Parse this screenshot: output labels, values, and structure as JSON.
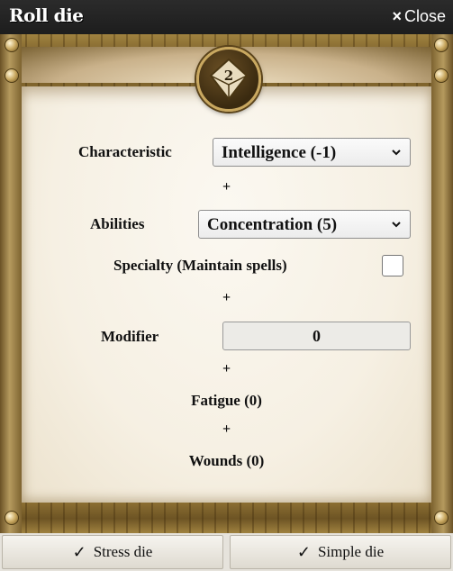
{
  "dialog": {
    "title": "Roll die",
    "close_label": "Close",
    "close_icon": "×"
  },
  "die": {
    "face": "2"
  },
  "form": {
    "characteristic": {
      "label": "Characteristic",
      "value": "Intelligence (-1)"
    },
    "plus1": "+",
    "abilities": {
      "label": "Abilities",
      "value": "Concentration (5)"
    },
    "specialty": {
      "label": "Specialty (Maintain spells)",
      "checked": false
    },
    "plus2": "+",
    "modifier": {
      "label": "Modifier",
      "value": "0"
    },
    "plus3": "+",
    "fatigue": {
      "label": "Fatigue (0)"
    },
    "plus4": "+",
    "wounds": {
      "label": "Wounds (0)"
    }
  },
  "buttons": {
    "stress": {
      "label": "Stress die",
      "icon": "✓"
    },
    "simple": {
      "label": "Simple die",
      "icon": "✓"
    }
  },
  "colors": {
    "frame": "#8a6d3b",
    "parchment": "#f6f0e3",
    "titlebar": "#222222"
  }
}
